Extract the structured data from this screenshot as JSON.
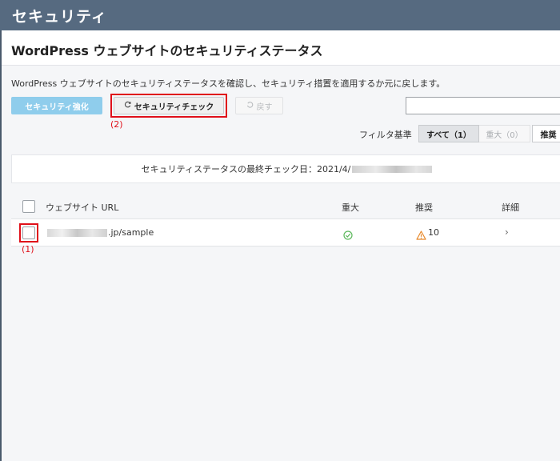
{
  "window": {
    "title": "セキュリティ"
  },
  "panel": {
    "title": "WordPress ウェブサイトのセキュリティステータス",
    "description": "WordPress ウェブサイトのセキュリティステータスを確認し、セキュリティ措置を適用するか元に戻します。"
  },
  "toolbar": {
    "harden_label": "セキュリティ強化",
    "check_label": "セキュリティチェック",
    "undo_label": "戻す",
    "search_placeholder": ""
  },
  "annotations": {
    "one": "(1)",
    "two": "(2)"
  },
  "filter": {
    "label": "フィルタ基準",
    "all_label": "すべて（1）",
    "critical_label": "重大（0）",
    "recommended_label": "推奨"
  },
  "status": {
    "last_check_label": "セキュリティステータスの最終チェック日：2021/4/"
  },
  "table": {
    "columns": {
      "url": "ウェブサイト URL",
      "critical": "重大",
      "recommended": "推奨",
      "details": "詳細"
    },
    "rows": [
      {
        "url_suffix": ".jp/sample",
        "critical_status": "ok",
        "recommended_count": "10"
      }
    ]
  },
  "colors": {
    "titlebar": "#566a80",
    "primary_button": "#8fcdec",
    "annotation": "#e0101a",
    "ok": "#5cb85c",
    "warning": "#e8892a"
  }
}
